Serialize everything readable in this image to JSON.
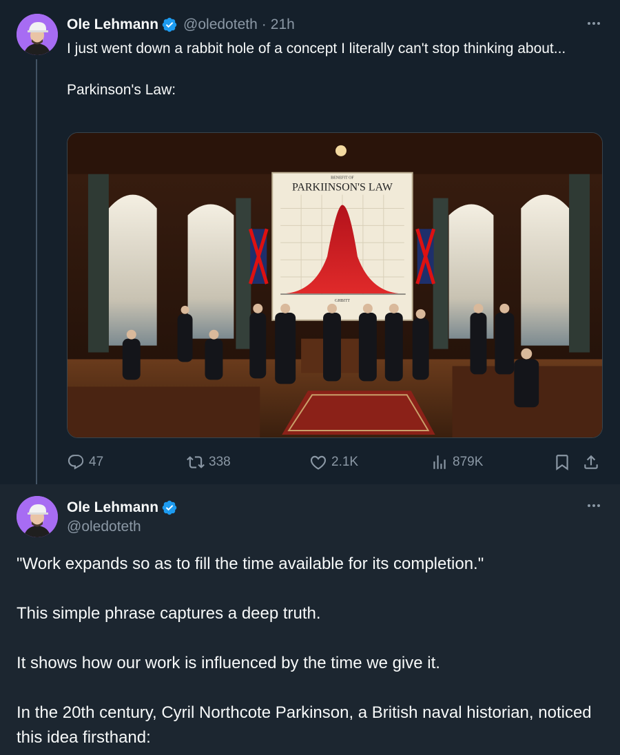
{
  "tweet1": {
    "author": {
      "name": "Ole Lehmann",
      "handle": "@oledoteth",
      "separator": "·",
      "time": "21h"
    },
    "text_lines": [
      "I just went down a rabbit hole of a concept I literally can't stop thinking about...",
      "Parkinson's Law:"
    ],
    "media": {
      "poster_title": "PARKIINSON'S LAW",
      "poster_subtitle": "BENEFIT OF",
      "poster_caption": "GHBITT"
    },
    "actions": {
      "replies": "47",
      "retweets": "338",
      "likes": "2.1K",
      "views": "879K"
    },
    "icons": {
      "reply": "reply-icon",
      "retweet": "retweet-icon",
      "like": "heart-icon",
      "views": "views-icon",
      "bookmark": "bookmark-icon",
      "share": "share-icon",
      "more": "more-icon",
      "verified": "verified-badge-icon"
    }
  },
  "tweet2": {
    "author": {
      "name": "Ole Lehmann",
      "handle": "@oledoteth"
    },
    "paragraphs": [
      "\"Work expands so as to fill the time available for its completion.\"",
      "This simple phrase captures a deep truth.",
      "It shows how our work is influenced by the time we give it.",
      "In the 20th century, Cyril Northcote Parkinson, a British naval historian, noticed this idea firsthand:"
    ]
  },
  "colors": {
    "background": "#15202b",
    "reply_background": "#1c2630",
    "text": "#f7f9f9",
    "muted": "#8b98a5",
    "verified": "#1d9bf0",
    "avatar": "#a76cf3"
  }
}
